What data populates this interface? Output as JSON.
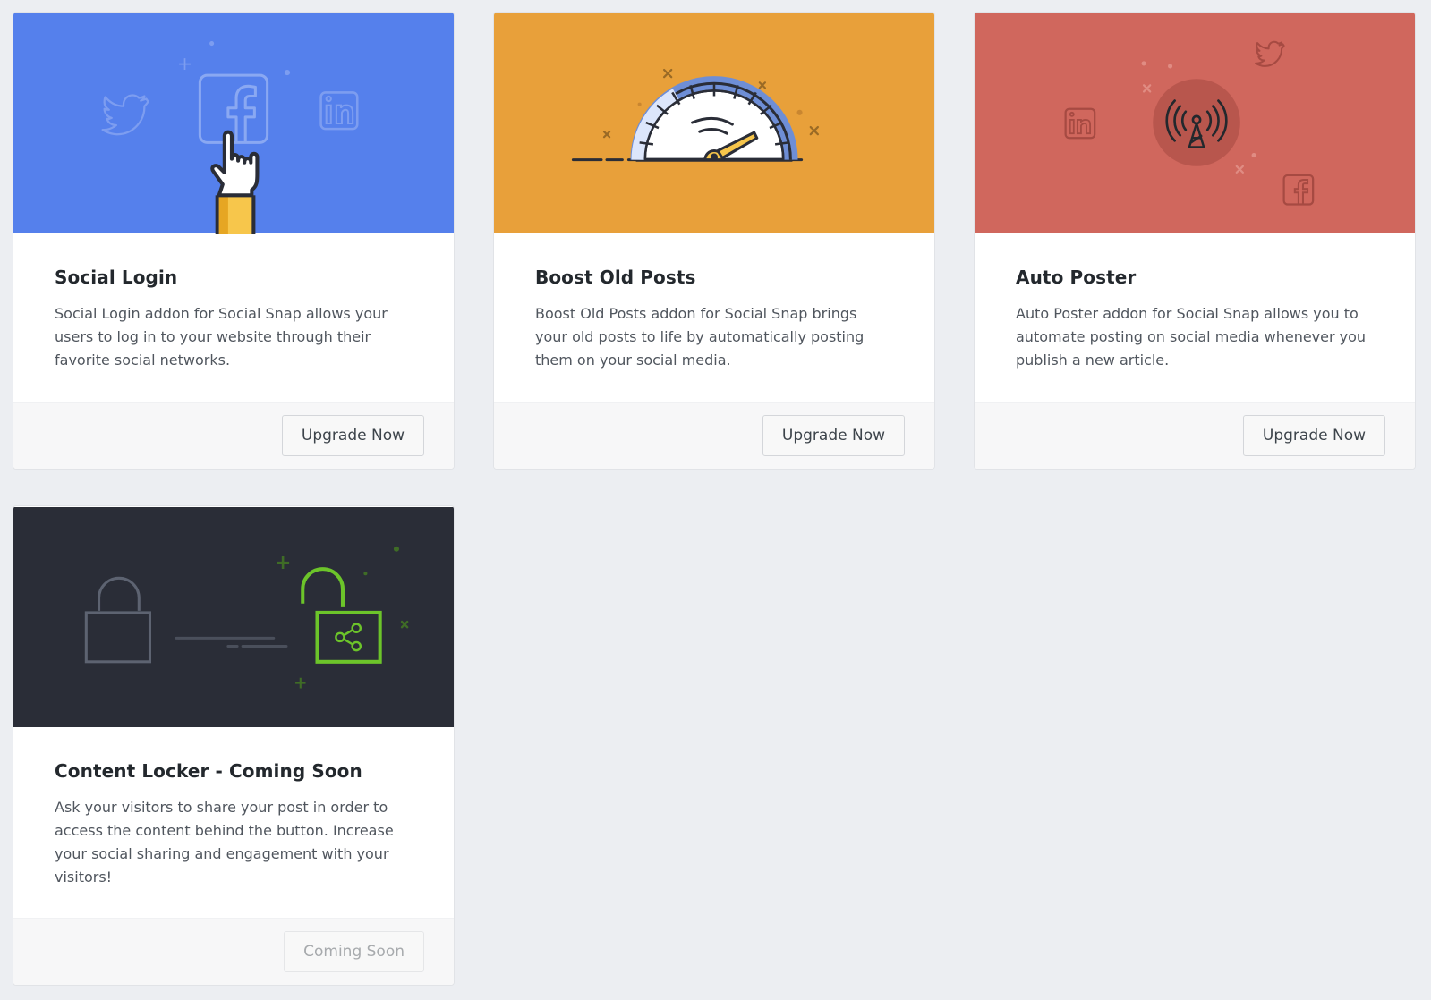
{
  "addons": [
    {
      "title": "Social Login",
      "description": "Social Login addon for Social Snap allows your users to log in to your website through their favorite social networks.",
      "button_label": "Upgrade Now",
      "banner_color": "#5580ec"
    },
    {
      "title": "Boost Old Posts",
      "description": "Boost Old Posts addon for Social Snap brings your old posts to life by automatically posting them on your social media.",
      "button_label": "Upgrade Now",
      "banner_color": "#e8a03a"
    },
    {
      "title": "Auto Poster",
      "description": "Auto Poster addon for Social Snap allows you to automate posting on social media whenever you publish a new article.",
      "button_label": "Upgrade Now",
      "banner_color": "#d0675d"
    },
    {
      "title": "Content Locker - Coming Soon",
      "description": "Ask your visitors to share your post in order to access the content behind the button. Increase your social sharing and engagement with your visitors!",
      "button_label": "Coming Soon",
      "button_disabled": true,
      "banner_color": "#2a2d37"
    }
  ],
  "colors": {
    "page_background": "#eceef2",
    "lock_accent": "#6cc42a"
  }
}
